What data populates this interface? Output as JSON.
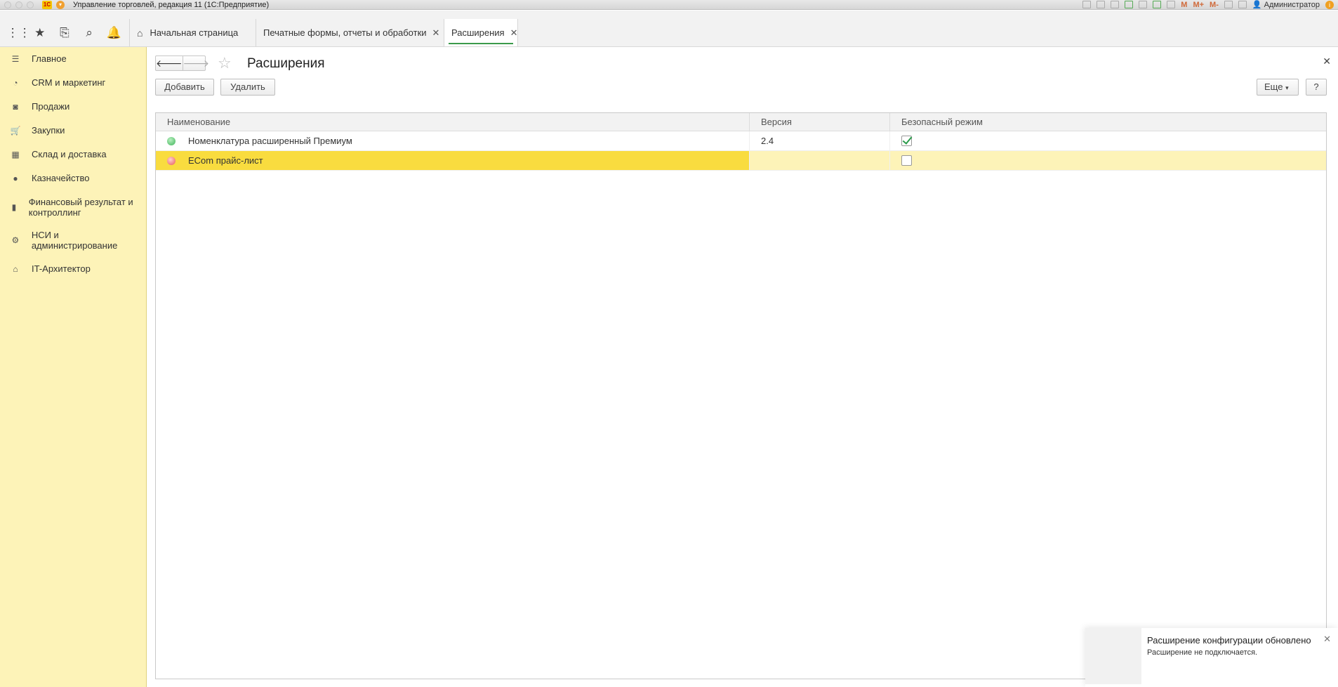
{
  "titlebar": {
    "app_title": "Управление торговлей, редакция 11  (1С:Предприятие)",
    "m1": "M",
    "m2": "M+",
    "m3": "M-",
    "user": "Администратор"
  },
  "toolbar": {
    "icons": [
      "apps-grid-icon",
      "star-icon",
      "history-icon",
      "search-icon",
      "bell-icon"
    ]
  },
  "tabs": [
    {
      "label": "Начальная страница"
    },
    {
      "label": "Печатные формы, отчеты и обработки"
    },
    {
      "label": "Расширения"
    }
  ],
  "sidebar": {
    "items": [
      {
        "label": "Главное",
        "icon": "menu-icon"
      },
      {
        "label": "CRM и маркетинг",
        "icon": "pie-chart-icon"
      },
      {
        "label": "Продажи",
        "icon": "bag-icon"
      },
      {
        "label": "Закупки",
        "icon": "cart-icon"
      },
      {
        "label": "Склад и доставка",
        "icon": "warehouse-icon"
      },
      {
        "label": "Казначейство",
        "icon": "coin-icon"
      },
      {
        "label": "Финансовый результат и контроллинг",
        "icon": "bar-chart-icon"
      },
      {
        "label": "НСИ и администрирование",
        "icon": "gear-icon"
      },
      {
        "label": "IT-Архитектор",
        "icon": "building-icon"
      }
    ]
  },
  "form": {
    "title": "Расширения",
    "add_label": "Добавить",
    "delete_label": "Удалить",
    "more_label": "Еще",
    "help_label": "?"
  },
  "table": {
    "headers": [
      "Наименование",
      "Версия",
      "Безопасный режим"
    ],
    "rows": [
      {
        "name": "Номенклатура расширенный Премиум",
        "version": "2.4",
        "safe_mode": true,
        "status": "active",
        "status_color": "#3fb45a"
      },
      {
        "name": "ECom прайс-лист",
        "version": "",
        "safe_mode": false,
        "status": "inactive",
        "status_color": "#e85a5a",
        "selected": true
      }
    ]
  },
  "notification": {
    "title": "Расширение конфигурации обновлено",
    "text": "Расширение не подключается."
  },
  "colors": {
    "sidebar_bg": "#fdf3b8",
    "selection": "#f9dc3f",
    "accent": "#3b9a4a"
  }
}
